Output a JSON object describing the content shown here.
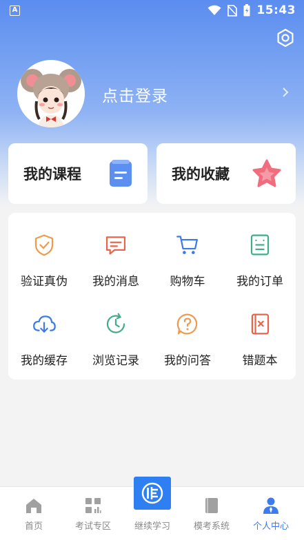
{
  "status_bar": {
    "time": "15:43",
    "app_badge": "A"
  },
  "profile": {
    "login_text": "点击登录"
  },
  "cards": [
    {
      "label": "我的课程",
      "icon": "course-doc-icon"
    },
    {
      "label": "我的收藏",
      "icon": "star-icon"
    }
  ],
  "grid": [
    {
      "label": "验证真伪",
      "icon": "shield-check-icon"
    },
    {
      "label": "我的消息",
      "icon": "message-icon"
    },
    {
      "label": "购物车",
      "icon": "cart-icon"
    },
    {
      "label": "我的订单",
      "icon": "order-icon"
    },
    {
      "label": "我的缓存",
      "icon": "cloud-download-icon"
    },
    {
      "label": "浏览记录",
      "icon": "history-icon"
    },
    {
      "label": "我的问答",
      "icon": "question-icon"
    },
    {
      "label": "错题本",
      "icon": "wrong-book-icon"
    }
  ],
  "nav": [
    {
      "label": "首页",
      "icon": "home-icon"
    },
    {
      "label": "考试专区",
      "icon": "grid-chart-icon"
    },
    {
      "label": "继续学习",
      "icon": "study-logo-icon"
    },
    {
      "label": "模考系统",
      "icon": "book-icon"
    },
    {
      "label": "个人中心",
      "icon": "person-icon",
      "active": true
    }
  ],
  "colors": {
    "accent": "#3d7bf0",
    "header_top": "#5b8df0"
  }
}
